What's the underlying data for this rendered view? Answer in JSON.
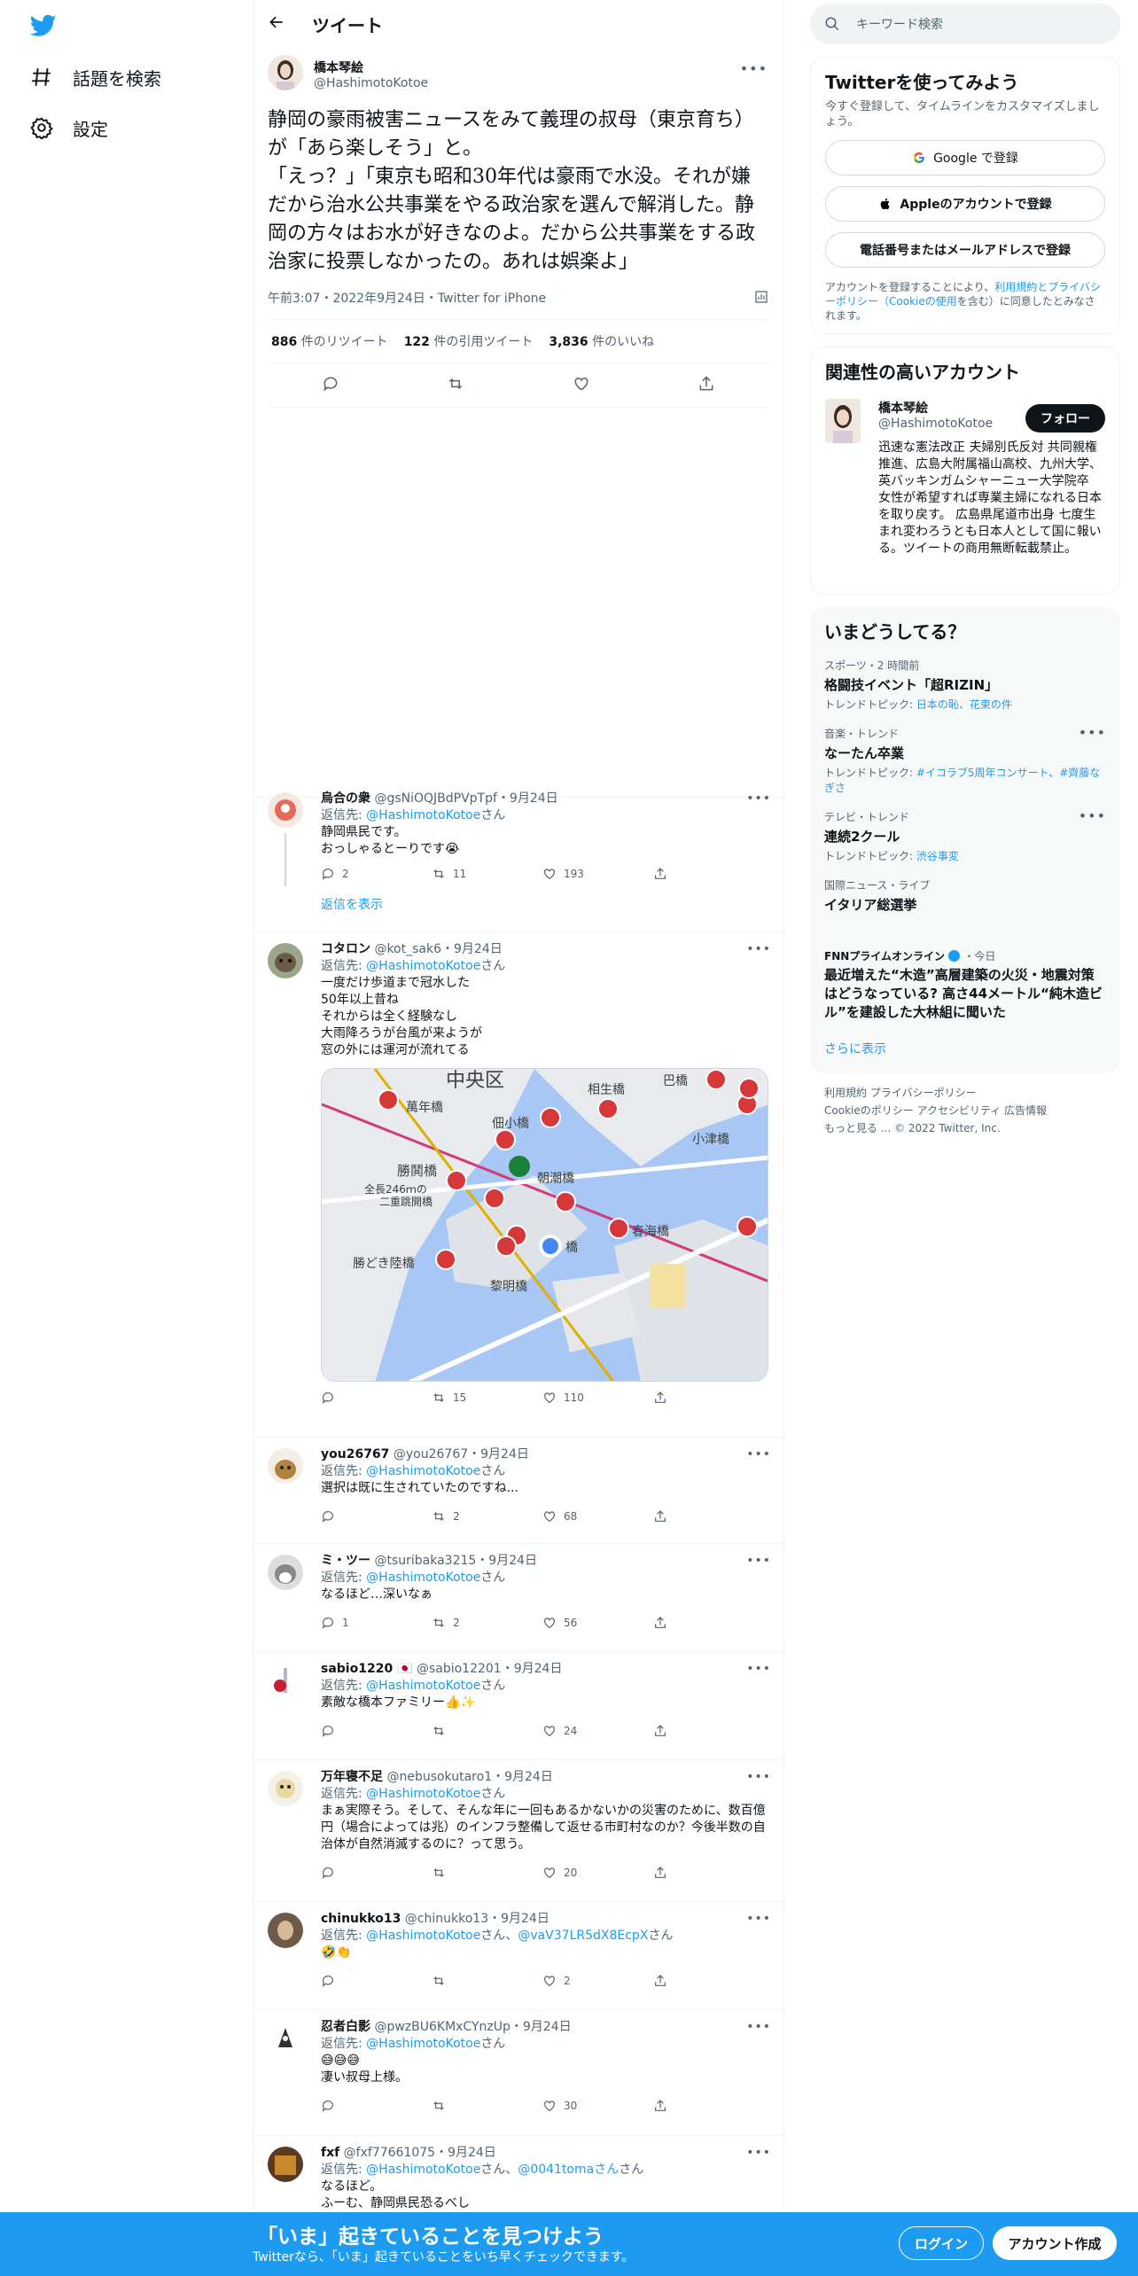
{
  "nav": {
    "items": [
      {
        "label": "話題を検索"
      },
      {
        "label": "設定"
      }
    ]
  },
  "header": {
    "title": "ツイート"
  },
  "main_tweet": {
    "name": "橋本琴絵",
    "handle": "@HashimotoKotoe",
    "text": "静岡の豪雨被害ニュースをみて義理の叔母（東京育ち）が「あら楽しそう」と。\n「えっ？」「東京も昭和30年代は豪雨で水没。それが嫌だから治水公共事業をやる政治家を選んで解消した。静岡の方々はお水が好きなのよ。だから公共事業をする政治家に投票しなかったの。あれは娯楽よ」",
    "meta": "午前3:07・2022年9月24日・Twitter for iPhone",
    "retweets": "886",
    "retweets_label": "件のリツイート",
    "quotes": "122",
    "quotes_label": "件の引用ツイート",
    "likes": "3,836",
    "likes_label": "件のいいね"
  },
  "reply_to_label": "返信先:",
  "san": "さん",
  "show_replies": "返信を表示",
  "replies": [
    {
      "name": "烏合の衆",
      "handle": "@gsNiOQJBdPVpTpf",
      "date": "・9月24日",
      "to": "@HashimotoKotoe",
      "text": "静岡県民です。\nおっしゃるとーりです😭",
      "reply": "2",
      "retweet": "11",
      "like": "193"
    },
    {
      "name": "コタロン",
      "handle": "@kot_sak6",
      "date": "・9月24日",
      "to": "@HashimotoKotoe",
      "text": "一度だけ歩道まで冠水した\n50年以上昔ね\nそれからは全く経験なし\n大雨降ろうが台風が来ようが\n窓の外には運河が流れてる",
      "reply": "",
      "retweet": "15",
      "like": "110"
    },
    {
      "name": "you26767",
      "handle": "@you26767",
      "date": "・9月24日",
      "to": "@HashimotoKotoe",
      "text": "選択は既に生されていたのですね...",
      "reply": "",
      "retweet": "2",
      "like": "68"
    },
    {
      "name": "ミ・ツー",
      "handle": "@tsuribaka3215",
      "date": "・9月24日",
      "to": "@HashimotoKotoe",
      "text": "なるほど…深いなぁ",
      "reply": "1",
      "retweet": "2",
      "like": "56"
    },
    {
      "name": "sabio1220 🇯🇵",
      "handle": "@sabio12201",
      "date": "・9月24日",
      "to": "@HashimotoKotoe",
      "text": "素敵な橋本ファミリー👍✨",
      "reply": "",
      "retweet": "",
      "like": "24"
    },
    {
      "name": "万年寝不足",
      "handle": "@nebusokutaro1",
      "date": "・9月24日",
      "to": "@HashimotoKotoe",
      "text": "まぁ実際そう。そして、そんな年に一回もあるかないかの災害のために、数百億円（場合によっては兆）のインフラ整備して返せる市町村なのか？今後半数の自治体が自然消滅するのに？って思う。",
      "reply": "",
      "retweet": "",
      "like": "20"
    },
    {
      "name": "chinukko13",
      "handle": "@chinukko13",
      "date": "・9月24日",
      "to": "@HashimotoKotoe",
      "to2": "@vaV37LR5dX8EcpX",
      "text": "🤣👏",
      "reply": "",
      "retweet": "",
      "like": "2"
    },
    {
      "name": "忍者白影",
      "handle": "@pwzBU6KMxCYnzUp",
      "date": "・9月24日",
      "to": "@HashimotoKotoe",
      "text": "😅😅😅\n凄い叔母上様。",
      "reply": "",
      "retweet": "",
      "like": "30"
    },
    {
      "name": "fxf",
      "handle": "@fxf77661075",
      "date": "・9月24日",
      "to": "@HashimotoKotoe",
      "to2": "@0041tomaさん",
      "text": "なるほど。\nふーむ、静岡県民恐るべし",
      "reply": "",
      "retweet": "",
      "like": ""
    }
  ],
  "map": {
    "labels": [
      "中央区",
      "萬年橋",
      "佃小橋",
      "相生橋",
      "巴橋",
      "小津橋",
      "勝鬨橋",
      "全長246ｍの",
      "二重跳開橋",
      "朝潮橋",
      "春海橋",
      "勝どき陸橋",
      "黎明橋",
      "橋"
    ]
  },
  "search": {
    "placeholder": "キーワード検索"
  },
  "signup_card": {
    "title": "Twitterを使ってみよう",
    "sub": "今すぐ登録して、タイムラインをカスタマイズしましょう。",
    "google": "Google で登録",
    "apple": "Appleのアカウントで登録",
    "phone": "電話番号またはメールアドレスで登録",
    "legal_pre": "アカウントを登録することにより、",
    "legal_link": "利用規約とプライバシーポリシー（Cookieの使用",
    "legal_post": "を含む）に同意したとみなされます。"
  },
  "related": {
    "title": "関連性の高いアカウント",
    "name": "橋本琴絵",
    "handle": "@HashimotoKotoe",
    "follow": "フォロー",
    "bio": "迅速な憲法改正 夫婦別氏反対 共同親権推進、広島大附属福山高校、九州大学、英バッキンガムシャーニュー大学院卒 女性が希望すれば専業主婦になれる日本を取り戻す。 広島県尾道市出身 七度生まれ変わろうとも日本人として国に報いる。ツイートの商用無断転載禁止。"
  },
  "trends": {
    "title": "いまどうしてる？",
    "items": [
      {
        "cat": "スポーツ・2 時間前",
        "title": "格闘技イベント「超RIZIN」",
        "topic_label": "トレンドトピック: ",
        "topic": "日本の恥、花束の件"
      },
      {
        "cat": "音楽・トレンド",
        "title": "なーたん卒業",
        "topic_label": "トレンドトピック: ",
        "topic": "#イコラブ5周年コンサート、#齊藤なぎさ"
      },
      {
        "cat": "テレビ・トレンド",
        "title": "連続2クール",
        "topic_label": "トレンドトピック: ",
        "topic": "渋谷事変"
      },
      {
        "cat": "国際ニュース・ライブ",
        "title": "イタリア総選挙"
      }
    ],
    "news_source": "FNNプライムオンライン",
    "news_time": "・今日",
    "news_title": "最近増えた“木造”高層建築の火災・地震対策はどうなっている? 高さ44メートル“純木造ビル”を建設した大林組に聞いた",
    "show_more": "さらに表示"
  },
  "footer": {
    "line1": "利用規約  プライバシーポリシー",
    "line2": "Cookieのポリシー  アクセシビリティ  広告情報",
    "line3": "もっと見る ...  © 2022 Twitter, Inc."
  },
  "bottom": {
    "title": "「いま」起きていることを見つけよう",
    "sub": "Twitterなら、「いま」起きていることをいち早くチェックできます。",
    "login": "ログイン",
    "signup": "アカウント作成"
  },
  "colors": {
    "accent": "#1d9bf0",
    "text": "#0f1419",
    "secondary": "#536471"
  }
}
